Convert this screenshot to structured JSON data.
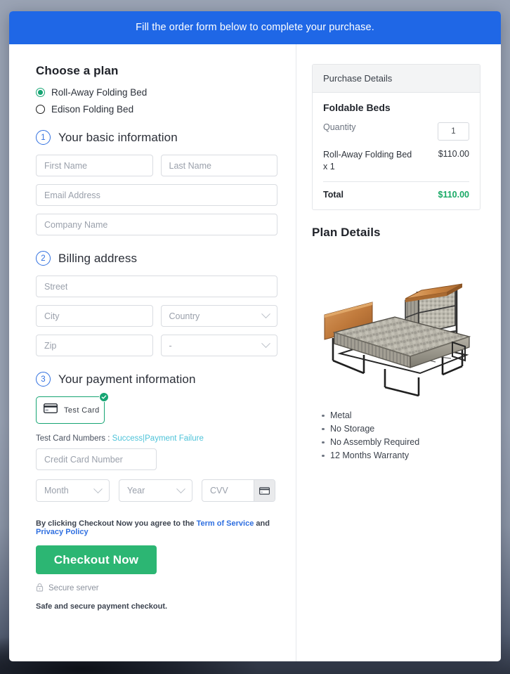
{
  "banner": {
    "text": "Fill the order form below to complete your purchase."
  },
  "plan": {
    "heading": "Choose a plan",
    "options": [
      {
        "label": "Roll-Away Folding Bed",
        "selected": true
      },
      {
        "label": "Edison Folding Bed",
        "selected": false
      }
    ]
  },
  "steps": {
    "basic": {
      "number": "1",
      "title": "Your basic information"
    },
    "billing": {
      "number": "2",
      "title": "Billing address"
    },
    "payment": {
      "number": "3",
      "title": "Your payment information"
    }
  },
  "basic_fields": {
    "first_name": {
      "placeholder": "First Name",
      "value": ""
    },
    "last_name": {
      "placeholder": "Last Name",
      "value": ""
    },
    "email": {
      "placeholder": "Email Address",
      "value": ""
    },
    "company": {
      "placeholder": "Company Name",
      "value": ""
    }
  },
  "billing_fields": {
    "street": {
      "placeholder": "Street",
      "value": ""
    },
    "city": {
      "placeholder": "City",
      "value": ""
    },
    "country": {
      "placeholder": "Country",
      "value": ""
    },
    "zip": {
      "placeholder": "Zip",
      "value": ""
    },
    "state": {
      "placeholder": "-",
      "value": ""
    }
  },
  "payment": {
    "method_tile": {
      "label": "Test Card",
      "icon": "credit-card-icon",
      "selected": true,
      "badge": "check-icon"
    },
    "test_numbers_prefix": "Test Card Numbers :",
    "test_success_link": "Success",
    "test_separator": "|",
    "test_failure_link": "Payment Failure",
    "card_number": {
      "placeholder": "Credit Card Number",
      "value": ""
    },
    "month": {
      "placeholder": "Month",
      "value": ""
    },
    "year": {
      "placeholder": "Year",
      "value": ""
    },
    "cvv": {
      "placeholder": "CVV",
      "value": "",
      "icon": "credit-card-icon"
    }
  },
  "legal": {
    "prefix": "By clicking Checkout Now you agree to the",
    "terms_link": "Term of Service",
    "conjunction": "and",
    "privacy_link": "Privacy Policy"
  },
  "actions": {
    "checkout_label": "Checkout Now",
    "secure_server": "Secure server",
    "secure_icon": "lock-icon",
    "safe_note": "Safe and secure payment checkout."
  },
  "purchase_details": {
    "header": "Purchase Details",
    "product_title": "Foldable Beds",
    "quantity_label": "Quantity",
    "quantity_value": "1",
    "line_item_desc": "Roll-Away Folding Bed x 1",
    "line_item_price": "$110.00",
    "total_label": "Total",
    "total_value": "$110.00"
  },
  "plan_details": {
    "heading": "Plan Details",
    "image_alt": "rollaway-folding-bed-photo",
    "features": [
      "Metal",
      "No Storage",
      "No Assembly Required",
      "12 Months Warranty"
    ]
  },
  "colors": {
    "banner_blue": "#1f67e6",
    "accent_green": "#2cb673",
    "radio_green": "#16a573",
    "total_green": "#18a965",
    "link_blue": "#2f6fe0",
    "link_teal": "#4ec3d9",
    "step_blue": "#2f6fe0"
  }
}
